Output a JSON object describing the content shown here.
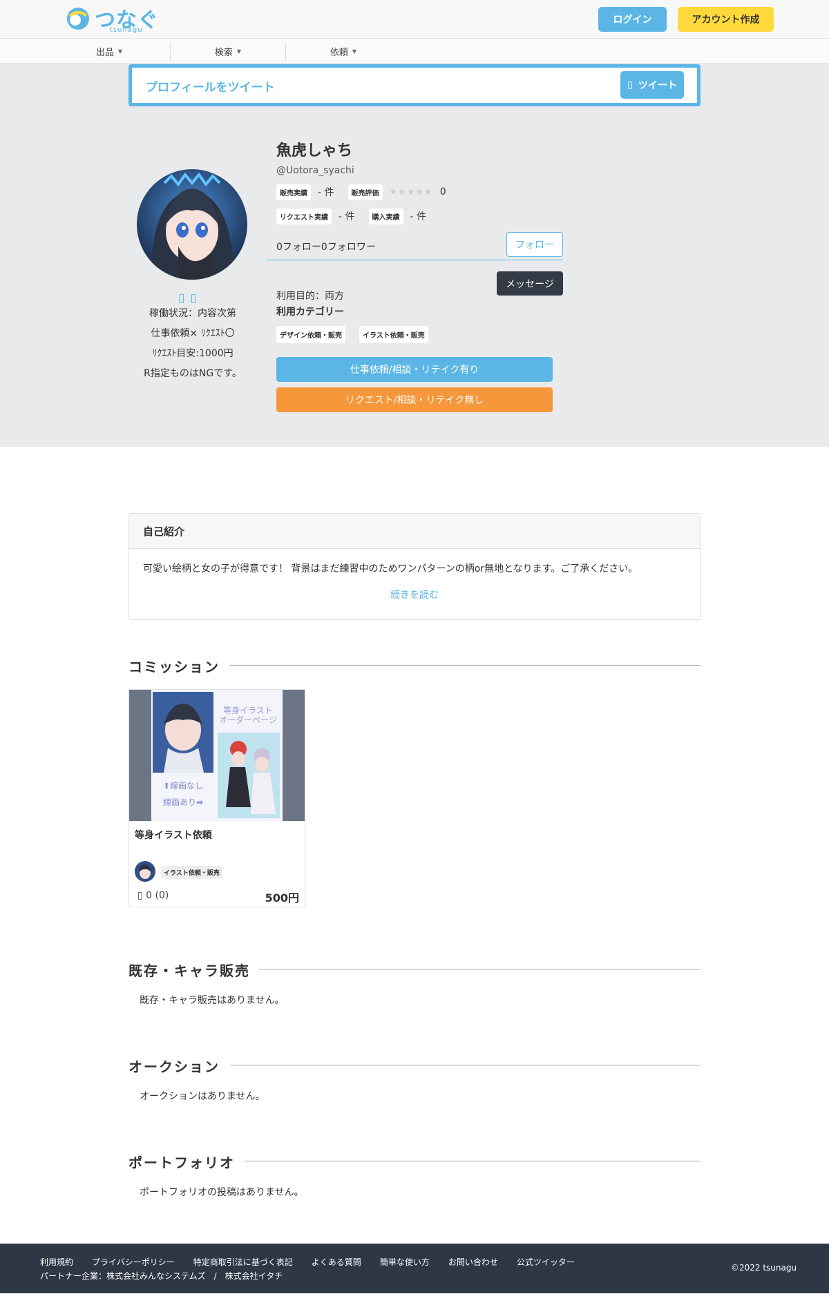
{
  "header": {
    "logo_text": "つなぐ",
    "logo_sub": "tsunagu",
    "login": "ログイン",
    "signup": "アカウント作成"
  },
  "nav": {
    "items": [
      "出品",
      "検索",
      "依頼"
    ]
  },
  "tweet": {
    "label": "プロフィールをツイート",
    "button": "ツイート"
  },
  "profile": {
    "name": "魚虎しゃち",
    "handle": "@Uotora_syachi",
    "sales_count_label": "販売実績",
    "sales_count_value": "- 件",
    "sales_rating_label": "販売評価",
    "stars": "★★★★★",
    "rating_value": "0",
    "request_count_label": "リクエスト実績",
    "request_count_value": "- 件",
    "purchase_count_label": "購入実績",
    "purchase_count_value": "- 件",
    "follow_text": "0フォロー0フォロワー",
    "follow_button": "フォロー",
    "message_button": "メッセージ",
    "purpose": "利用目的：両方",
    "category_title": "利用カテゴリー",
    "categories": [
      "デザイン依頼・販売",
      "イラスト依頼・販売"
    ],
    "action_blue": "仕事依頼/相談・リテイク有り",
    "action_orange": "リクエスト/相談・リテイク無し",
    "sns_icons": "",
    "left_info": [
      "稼働状況：内容次第",
      "仕事依頼× ﾘｸｴｽﾄ〇",
      "ﾘｸｴｽﾄ目安:1000円",
      "R指定ものはNGです。"
    ]
  },
  "intro": {
    "title": "自己紹介",
    "body": "可愛い絵柄と女の子が得意です！ 背景はまだ練習中のためワンパターンの柄or無地となります。ご了承ください。",
    "more": "続きを読む"
  },
  "commission": {
    "title": "コミッション",
    "card": {
      "thumb_text_right": "等身イラスト\nオーダーページ",
      "thumb_text_left1": "⬆線画なし",
      "thumb_text_left2": "線画あり➡",
      "title": "等身イラスト依頼",
      "tag": "イラスト依頼・販売",
      "likes": " 0 (0)",
      "price": "500円"
    }
  },
  "existing": {
    "title": "既存・キャラ販売",
    "empty": "既存・キャラ販売はありません。"
  },
  "auction": {
    "title": "オークション",
    "empty": "オークションはありません。"
  },
  "portfolio": {
    "title": "ポートフォリオ",
    "empty": "ポートフォリオの投稿はありません。"
  },
  "footer": {
    "links": [
      "利用規約",
      "プライバシーポリシー",
      "特定商取引法に基づく表記",
      "よくある質問",
      "簡単な使い方",
      "お問い合わせ",
      "公式ツイッター"
    ],
    "partner": "パートナー企業：株式会社みんなシステムズ　/　株式会社イタチ",
    "copyright": "©2022 tsunagu"
  },
  "colors": {
    "accent": "#5bb6e6",
    "signup": "#ffd93b",
    "orange": "#f5973a",
    "footer": "#2e3746",
    "band": "#e9eaec"
  }
}
